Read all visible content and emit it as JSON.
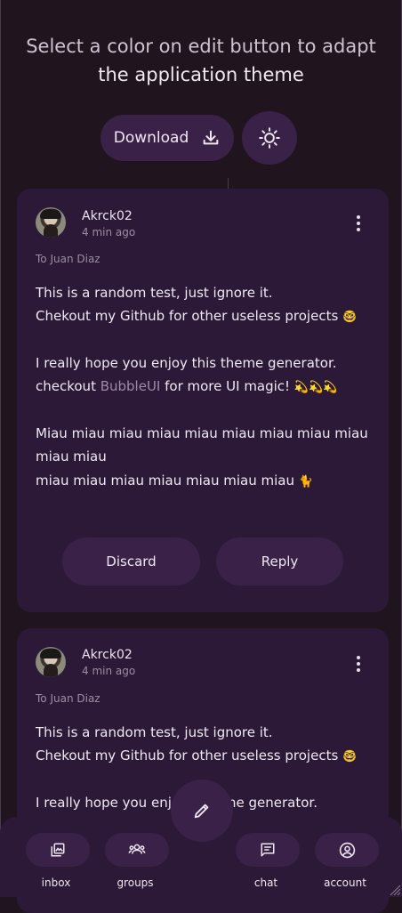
{
  "header": {
    "line1": "Select a color on edit button to adapt",
    "line2": "the application theme",
    "download_label": "Download"
  },
  "cards": [
    {
      "author": "Akrck02",
      "time": "4 min ago",
      "to": "To Juan Diaz",
      "p1a": "This is a random test, just ignore it.",
      "p1b": "Chekout my Github for other useless projects",
      "emoji1": "🤓",
      "p2a": "I really hope you enjoy this theme generator.",
      "p2b_pre": "checkout ",
      "p2b_link": "BubbleUI",
      "p2b_post": " for more UI magic! ",
      "emoji2": "💫💫💫",
      "p3a": "Miau miau miau miau miau miau miau miau miau",
      "p3b": "miau miau",
      "p3c": "miau miau miau miau miau miau miau",
      "emoji3": "🐈",
      "discard_label": "Discard",
      "reply_label": "Reply"
    },
    {
      "author": "Akrck02",
      "time": "4 min ago",
      "to": "To Juan Diaz",
      "p1a": "This is a random test, just ignore it.",
      "p1b": "Chekout my Github for other useless projects",
      "emoji1": "🤓",
      "p2a_pre": "I really hope you enjoy",
      "p2a_post": "me generator."
    }
  ],
  "nav": {
    "inbox": "inbox",
    "groups": "groups",
    "chat": "chat",
    "account": "account"
  },
  "icons": {
    "download": "download-icon",
    "theme": "sun-icon",
    "more": "more-vert-icon",
    "edit": "pencil-icon",
    "inbox": "inbox-icon",
    "groups": "groups-icon",
    "chat": "chat-icon",
    "account": "account-icon"
  },
  "colors": {
    "background": "#20141f",
    "surface": "#2b1937",
    "container": "#3a2147",
    "link": "#9f8aa8"
  }
}
